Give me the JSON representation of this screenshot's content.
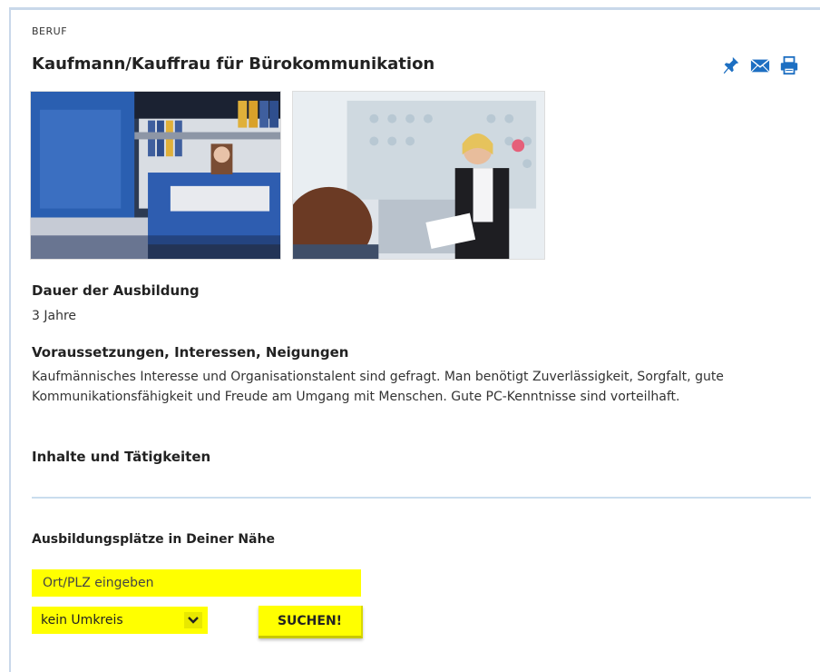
{
  "header": {
    "kicker": "BERUF",
    "title": "Kaufmann/Kauffrau für Bürokommunikation"
  },
  "toolbar": {
    "icons": [
      "pin-icon",
      "mail-icon",
      "print-icon"
    ]
  },
  "sections": {
    "dauer": {
      "heading": "Dauer der Ausbildung",
      "value": "3 Jahre"
    },
    "voraussetzungen": {
      "heading": "Voraussetzungen, Interessen, Neigungen",
      "text": "Kaufmännisches Interesse und Organisationstalent sind gefragt. Man benötigt Zuverlässigkeit, Sorgfalt, gute Kommunikationsfähigkeit und Freude am Umgang mit Menschen. Gute PC-Kenntnisse sind vorteilhaft."
    },
    "inhalte": {
      "heading": "Inhalte und Tätigkeiten"
    }
  },
  "search": {
    "heading": "Ausbildungsplätze in Deiner Nähe",
    "location_placeholder": "Ort/PLZ eingeben",
    "location_value": "",
    "radius_selected": "kein Umkreis",
    "button_label": "SUCHEN!"
  },
  "colors": {
    "accent_yellow": "#ffff00",
    "icon_blue": "#1d6fc2",
    "divider": "#c9ddee"
  }
}
